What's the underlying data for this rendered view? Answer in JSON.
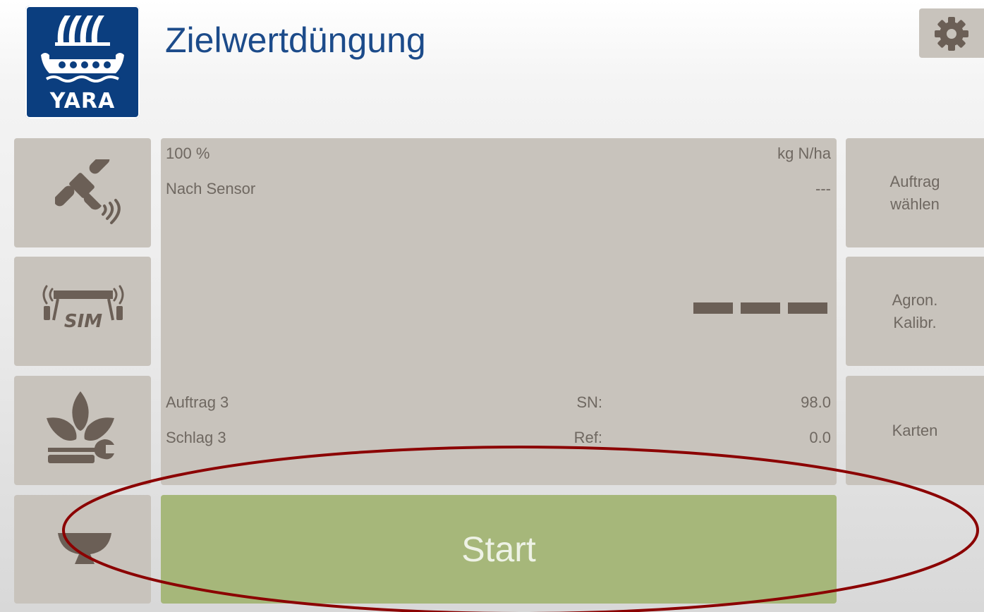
{
  "header": {
    "logo_text": "YARA",
    "title": "Zielwertdüngung"
  },
  "left_buttons": [
    {
      "icon": "satellite-icon"
    },
    {
      "icon": "sim-boom-icon"
    },
    {
      "icon": "plant-wrench-icon"
    },
    {
      "icon": "bowl-icon"
    }
  ],
  "right_buttons": {
    "auftrag_line1": "Auftrag",
    "auftrag_line2": "wählen",
    "agron_line1": "Agron.",
    "agron_line2": "Kalibr.",
    "karten": "Karten"
  },
  "panel": {
    "percent": "100 %",
    "unit": "kg N/ha",
    "mode": "Nach Sensor",
    "mode_value": "---",
    "auftrag": "Auftrag 3",
    "sn_label": "SN:",
    "sn_value": "98.0",
    "schlag": "Schlag 3",
    "ref_label": "Ref:",
    "ref_value": "0.0"
  },
  "start_label": "Start",
  "colors": {
    "brand_blue": "#0b3e7f",
    "title_blue": "#1c4b8a",
    "button_gray": "#c8c3bc",
    "start_green": "#a6b77a",
    "annotation_red": "#8b0000"
  }
}
